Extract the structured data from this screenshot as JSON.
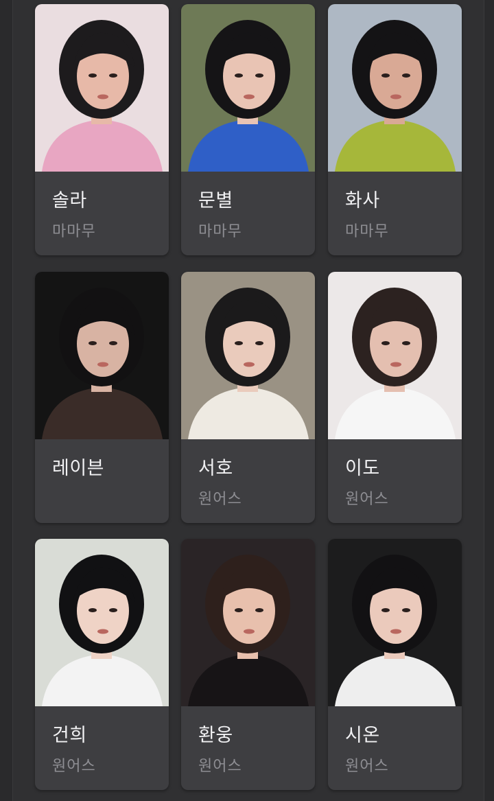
{
  "cards": [
    {
      "name": "솔라",
      "group": "마마무",
      "photo": "portrait-pink-bucket-hat",
      "colors": {
        "bg": "#eadde0",
        "accent": "#e8a6c2",
        "hair": "#1d1b1d",
        "skin": "#e7b9a8"
      }
    },
    {
      "name": "문별",
      "group": "마마무",
      "photo": "portrait-headband-blue-jacket",
      "colors": {
        "bg": "#6e7a56",
        "accent": "#2f5fc7",
        "hair": "#151416",
        "skin": "#e9c4b4"
      }
    },
    {
      "name": "화사",
      "group": "마마무",
      "photo": "portrait-lime-turtleneck-fence",
      "colors": {
        "bg": "#aeb8c4",
        "accent": "#a6b73a",
        "hair": "#141315",
        "skin": "#d9a995"
      }
    },
    {
      "name": "레이븐",
      "group": "",
      "photo": "portrait-dark-background",
      "colors": {
        "bg": "#141414",
        "accent": "#3a2c28",
        "hair": "#121112",
        "skin": "#d8b3a3"
      }
    },
    {
      "name": "서호",
      "group": "원어스",
      "photo": "portrait-white-knit-sweater",
      "colors": {
        "bg": "#9a9284",
        "accent": "#eeeae2",
        "hair": "#1b1a1b",
        "skin": "#eacbbc"
      }
    },
    {
      "name": "이도",
      "group": "원어스",
      "photo": "portrait-white-tshirt-light",
      "colors": {
        "bg": "#ece8e8",
        "accent": "#f6f6f6",
        "hair": "#2c2220",
        "skin": "#e4bfb0"
      }
    },
    {
      "name": "건희",
      "group": "원어스",
      "photo": "portrait-white-shirt-bright",
      "colors": {
        "bg": "#d9dcd6",
        "accent": "#f3f3f3",
        "hair": "#111113",
        "skin": "#efd3c6"
      }
    },
    {
      "name": "환웅",
      "group": "원어스",
      "photo": "portrait-black-shirt-hand",
      "colors": {
        "bg": "#2a2426",
        "accent": "#171416",
        "hair": "#2e201c",
        "skin": "#e8c0ad"
      }
    },
    {
      "name": "시온",
      "group": "원어스",
      "photo": "portrait-white-collar-dark",
      "colors": {
        "bg": "#1c1c1d",
        "accent": "#eeeeee",
        "hair": "#121113",
        "skin": "#ebcabc"
      }
    }
  ]
}
